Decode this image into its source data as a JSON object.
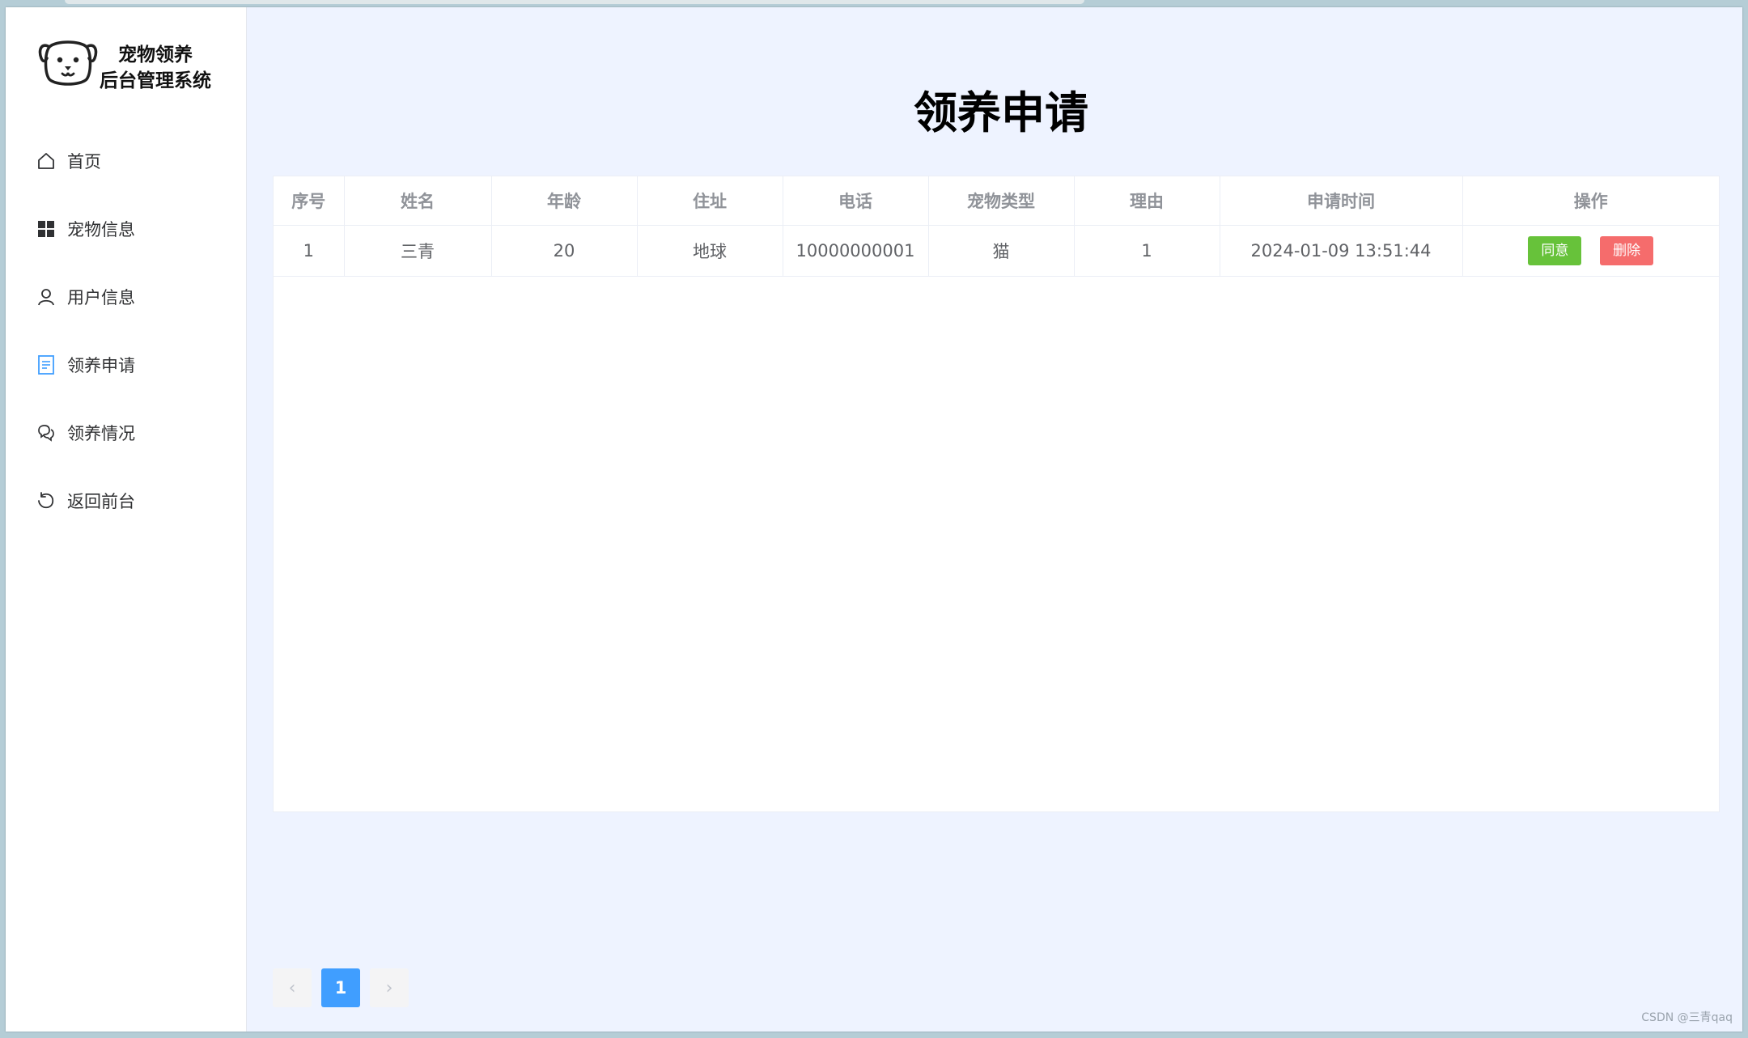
{
  "app": {
    "title_line1": "宠物领养",
    "title_line2": "后台管理系统"
  },
  "sidebar": {
    "items": [
      {
        "label": "首页",
        "icon": "home-icon"
      },
      {
        "label": "宠物信息",
        "icon": "grid-icon"
      },
      {
        "label": "用户信息",
        "icon": "user-icon"
      },
      {
        "label": "领养申请",
        "icon": "document-icon",
        "active": true
      },
      {
        "label": "领养情况",
        "icon": "chat-icon"
      },
      {
        "label": "返回前台",
        "icon": "refresh-icon"
      }
    ]
  },
  "main": {
    "title": "领养申请",
    "table": {
      "headers": [
        "序号",
        "姓名",
        "年龄",
        "住址",
        "电话",
        "宠物类型",
        "理由",
        "申请时间",
        "操作"
      ],
      "rows": [
        {
          "index": "1",
          "name": "三青",
          "age": "20",
          "address": "地球",
          "phone": "10000000001",
          "pet_type": "猫",
          "reason": "1",
          "apply_time": "2024-01-09 13:51:44",
          "agree_label": "同意",
          "delete_label": "删除"
        }
      ]
    },
    "pagination": {
      "prev": "‹",
      "current": "1",
      "next": "›"
    }
  },
  "watermark": "CSDN @三青qaq",
  "colors": {
    "primary": "#409eff",
    "agree": "#67c23a",
    "delete": "#f56c6c",
    "background": "#eef3ff"
  }
}
